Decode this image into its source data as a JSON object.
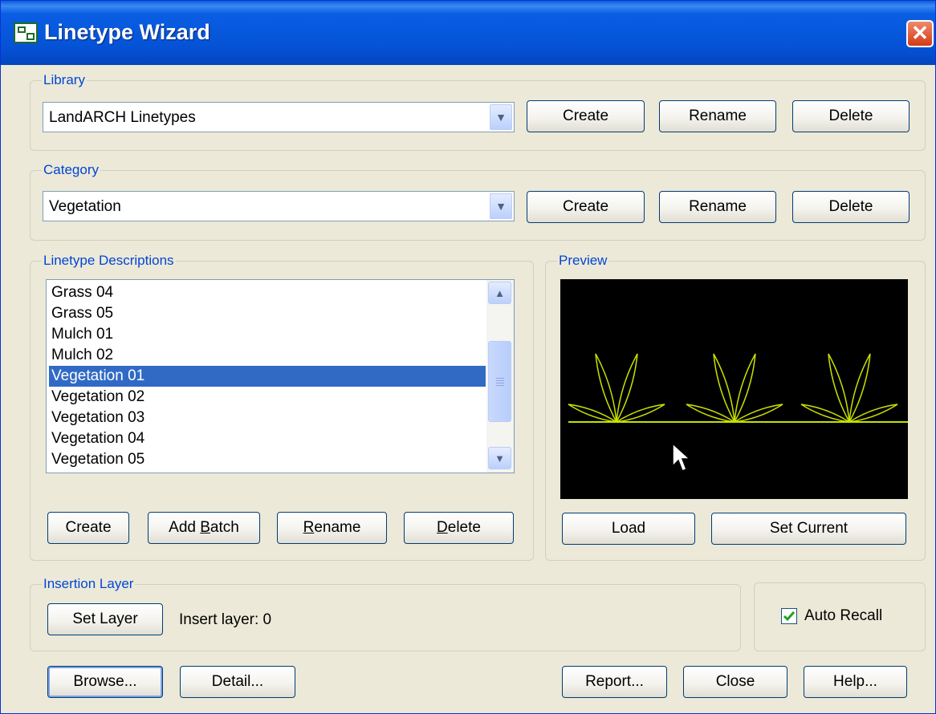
{
  "window": {
    "title": "Linetype Wizard",
    "close_glyph": "✕"
  },
  "library": {
    "legend": "Library",
    "selected": "LandARCH Linetypes",
    "buttons": {
      "create": "Create",
      "rename": "Rename",
      "delete": "Delete"
    }
  },
  "category": {
    "legend": "Category",
    "selected": "Vegetation",
    "buttons": {
      "create": "Create",
      "rename": "Rename",
      "delete": "Delete"
    }
  },
  "descriptions": {
    "legend": "Linetype Descriptions",
    "items": [
      "Grass 04",
      "Grass 05",
      "Mulch 01",
      "Mulch 02",
      "Vegetation 01",
      "Vegetation 02",
      "Vegetation 03",
      "Vegetation 04",
      "Vegetation 05"
    ],
    "selected_index": 4,
    "buttons": {
      "create": "Create",
      "add_batch_pre": "Add ",
      "add_batch_key": "B",
      "add_batch_post": "atch",
      "rename_key": "R",
      "rename_post": "ename",
      "delete_key": "D",
      "delete_post": "elete"
    }
  },
  "preview": {
    "legend": "Preview",
    "line_color": "#c8e000",
    "background": "#000000",
    "buttons": {
      "load": "Load",
      "set_current": "Set Current"
    }
  },
  "insertion_layer": {
    "legend": "Insertion Layer",
    "set_layer_label": "Set Layer",
    "insert_layer_text": "Insert layer: 0"
  },
  "auto_recall": {
    "label": "Auto Recall",
    "checked": true
  },
  "footer": {
    "browse": "Browse...",
    "detail": "Detail...",
    "report": "Report...",
    "close": "Close",
    "help": "Help..."
  },
  "icons": {
    "dropdown": "chevron-down-icon",
    "scroll_up": "scroll-up-icon",
    "scroll_down": "scroll-down-icon",
    "check": "check-icon",
    "cursor": "mouse-cursor-icon"
  }
}
